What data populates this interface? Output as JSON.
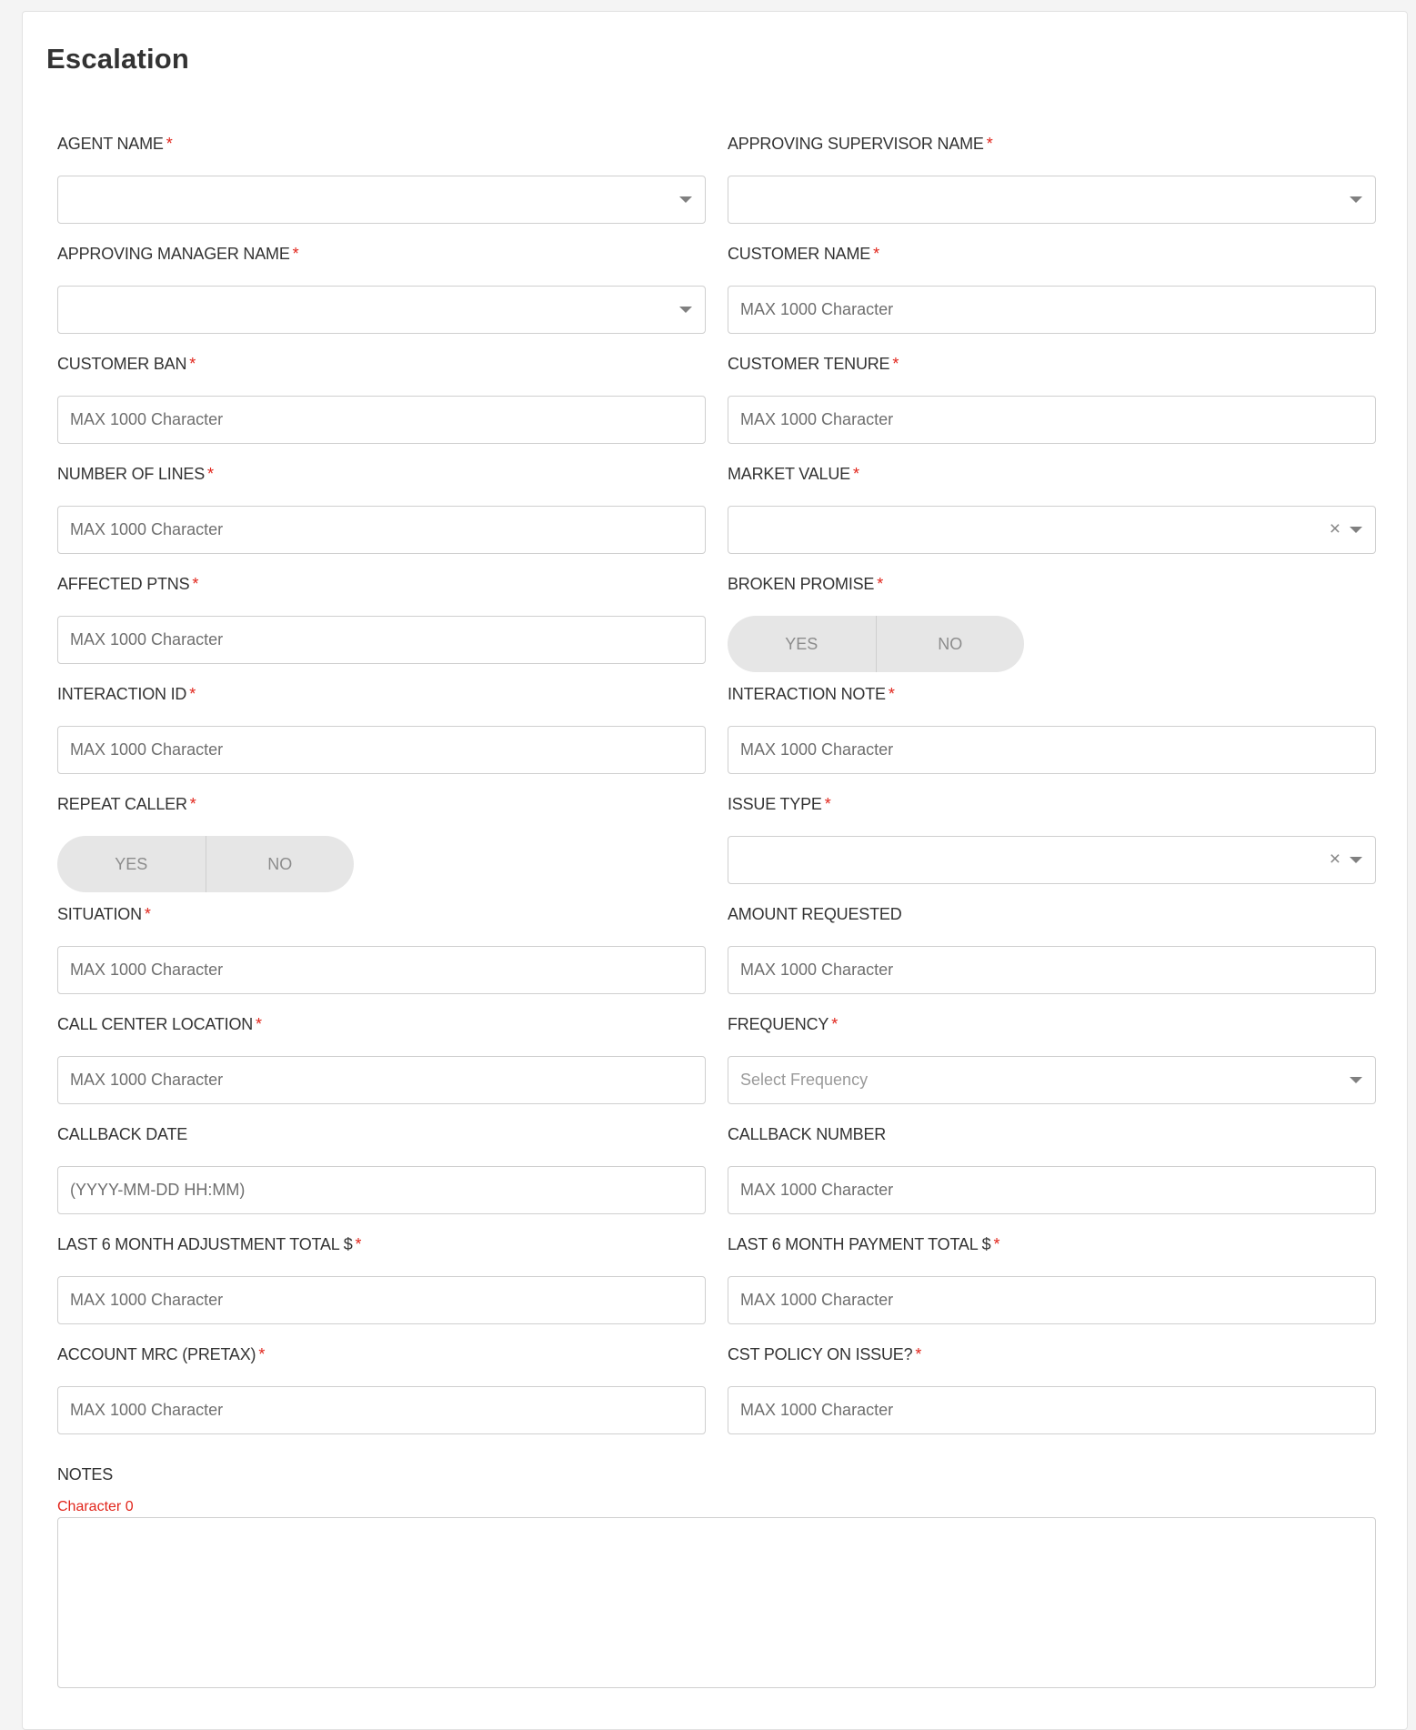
{
  "page": {
    "title": "Escalation"
  },
  "required_mark": "*",
  "fields": [
    {
      "label": "AGENT NAME",
      "required": true,
      "type": "select",
      "value": ""
    },
    {
      "label": "APPROVING SUPERVISOR NAME",
      "required": true,
      "type": "select",
      "value": ""
    },
    {
      "label": "APPROVING MANAGER NAME",
      "required": true,
      "type": "select",
      "value": ""
    },
    {
      "label": "CUSTOMER NAME",
      "required": true,
      "type": "text",
      "placeholder": "MAX 1000 Character"
    },
    {
      "label": "CUSTOMER BAN",
      "required": true,
      "type": "text",
      "placeholder": "MAX 1000 Character"
    },
    {
      "label": "CUSTOMER TENURE",
      "required": true,
      "type": "text",
      "placeholder": "MAX 1000 Character"
    },
    {
      "label": "NUMBER OF LINES",
      "required": true,
      "type": "text",
      "placeholder": "MAX 1000 Character"
    },
    {
      "label": "MARKET VALUE",
      "required": true,
      "type": "select-clearable",
      "value": "",
      "clear_icon": "×"
    },
    {
      "label": "AFFECTED PTNS",
      "required": true,
      "type": "text",
      "placeholder": "MAX 1000 Character"
    },
    {
      "label": "BROKEN PROMISE",
      "required": true,
      "type": "toggle",
      "options": [
        "YES",
        "NO"
      ]
    },
    {
      "label": "INTERACTION ID",
      "required": true,
      "type": "text",
      "placeholder": "MAX 1000 Character"
    },
    {
      "label": "INTERACTION NOTE",
      "required": true,
      "type": "text",
      "placeholder": "MAX 1000 Character"
    },
    {
      "label": "REPEAT CALLER",
      "required": true,
      "type": "toggle",
      "options": [
        "YES",
        "NO"
      ]
    },
    {
      "label": "ISSUE TYPE",
      "required": true,
      "type": "select-clearable",
      "value": "",
      "clear_icon": "×"
    },
    {
      "label": "SITUATION",
      "required": true,
      "type": "text",
      "placeholder": "MAX 1000 Character"
    },
    {
      "label": "AMOUNT REQUESTED",
      "required": false,
      "type": "text",
      "placeholder": "MAX 1000 Character"
    },
    {
      "label": "CALL CENTER LOCATION",
      "required": true,
      "type": "text",
      "placeholder": "MAX 1000 Character"
    },
    {
      "label": "FREQUENCY",
      "required": true,
      "type": "select",
      "placeholder": "Select Frequency",
      "value": ""
    },
    {
      "label": "CALLBACK DATE",
      "required": false,
      "type": "text",
      "placeholder": "(YYYY-MM-DD HH:MM)"
    },
    {
      "label": "CALLBACK NUMBER",
      "required": false,
      "type": "text",
      "placeholder": "MAX 1000 Character"
    },
    {
      "label": "LAST 6 MONTH ADJUSTMENT TOTAL $",
      "required": true,
      "type": "text",
      "placeholder": "MAX 1000 Character"
    },
    {
      "label": "LAST 6 MONTH PAYMENT TOTAL $",
      "required": true,
      "type": "text",
      "placeholder": "MAX 1000 Character"
    },
    {
      "label": "ACCOUNT MRC (PRETAX)",
      "required": true,
      "type": "text",
      "placeholder": "MAX 1000 Character"
    },
    {
      "label": "CST POLICY ON ISSUE?",
      "required": true,
      "type": "text",
      "placeholder": "MAX 1000 Character"
    }
  ],
  "notes": {
    "label": "NOTES",
    "counter": "Character 0",
    "value": ""
  },
  "colors": {
    "required": "#e1251b",
    "counter": "#e1251b",
    "border": "#cfcfcf",
    "toggle_bg": "#e6e6e6"
  }
}
